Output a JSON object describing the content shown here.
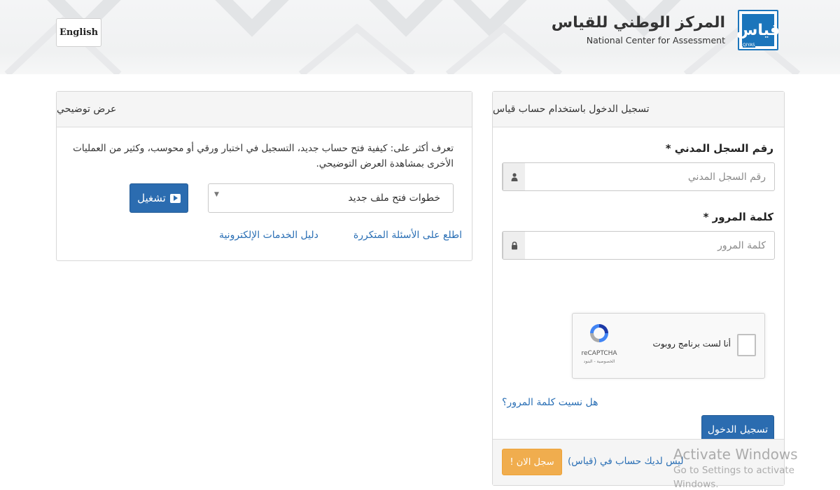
{
  "header": {
    "language_button": "English",
    "brand_ar": "المركز الوطني للقياس",
    "brand_en": "National Center for Assessment",
    "logo_text": "قياس",
    "logo_caption": "QIYAS"
  },
  "demo": {
    "title": "عرض توضيحي",
    "description": "تعرف أكثر على: كيفية فتح حساب جديد، التسجيل في اختبار ورقي أو محوسب، وكثير من العمليات الأخرى بمشاهدة العرض التوضيحي.",
    "select_value": "خطوات فتح ملف جديد",
    "play_label": "تشغيل",
    "links": {
      "faq": "اطلع على الأسئلة المتكررة",
      "guide": "دليل الخدمات الإلكترونية"
    }
  },
  "login": {
    "title": "تسجيل الدخول باستخدام حساب قياس",
    "id_label": "رقم السجل المدني *",
    "id_placeholder": "رقم السجل المدني",
    "password_label": "كلمة المرور *",
    "password_placeholder": "كلمة المرور",
    "recaptcha": {
      "label": "أنا لست برنامج روبوت",
      "brand": "reCAPTCHA",
      "terms": "الخصوصية - البنود"
    },
    "forgot_password": "هل نسيت كلمة المرور؟",
    "submit": "تسجيل الدخول",
    "no_account": "ليس لديك حساب في (قياس)",
    "register": "سجل الان !"
  },
  "watermark": {
    "title": "Activate Windows",
    "subtitle": "Go to Settings to activate Windows."
  },
  "colors": {
    "primary": "#2b6cb0",
    "warning": "#f0ad4e",
    "link": "#2a6fb5",
    "brand_blue": "#1b75bb"
  }
}
